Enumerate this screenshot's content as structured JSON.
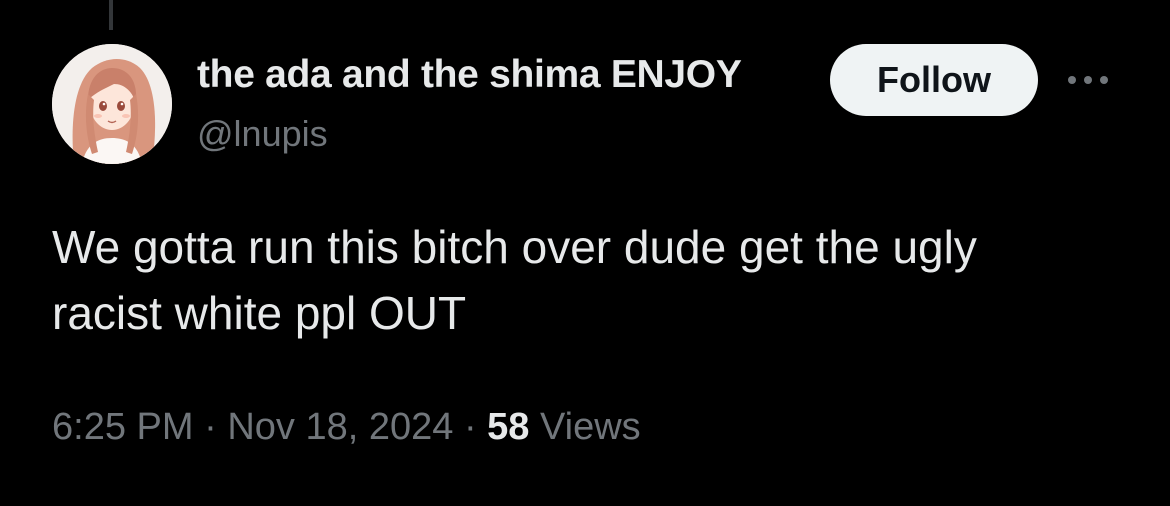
{
  "tweet": {
    "author": {
      "display_name": "the ada and the shima ENJOY",
      "handle": "@lnupis",
      "avatar_icon": "anime-girl-avatar"
    },
    "follow_label": "Follow",
    "more_icon": "more-horizontal-icon",
    "text": "We gotta run this bitch over dude get the ugly\nracist white ppl OUT",
    "time": "6:25 PM",
    "separator": "·",
    "date": "Nov 18, 2024",
    "views_count": "58",
    "views_label": "Views"
  },
  "colors": {
    "background": "#000000",
    "primary_text": "#e7e9ea",
    "secondary_text": "#71767b",
    "follow_button_bg": "#eff3f4",
    "follow_button_text": "#0f1419"
  }
}
